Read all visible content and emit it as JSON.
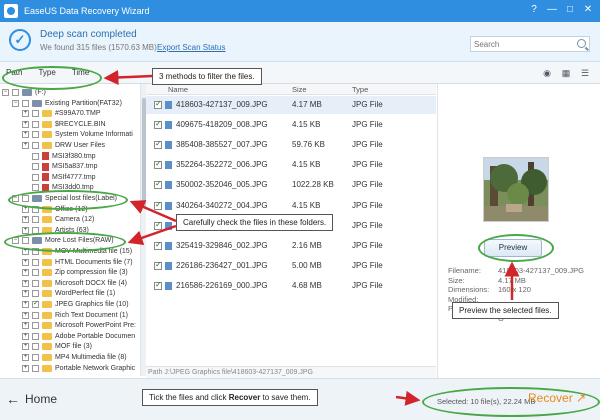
{
  "window": {
    "title": "EaseUS Data Recovery Wizard",
    "controls": [
      "?",
      "—",
      "□",
      "✕"
    ]
  },
  "scan": {
    "status": "Deep scan completed",
    "summary": "We found 315 files (1570.63 MB)",
    "export_link": "Export Scan Status",
    "search_placeholder": "Search"
  },
  "filter_tabs": [
    "Path",
    "Type",
    "Time"
  ],
  "tree": [
    {
      "label": "(F:)",
      "depth": 0,
      "kind": "drive"
    },
    {
      "label": "Existing Partition(FAT32)",
      "depth": 1,
      "kind": "drive"
    },
    {
      "label": "#S99A70.TMP",
      "depth": 2,
      "kind": "folder"
    },
    {
      "label": "$RECYCLE.BIN",
      "depth": 2,
      "kind": "folder"
    },
    {
      "label": "System Volume Informati",
      "depth": 2,
      "kind": "folder"
    },
    {
      "label": "DRW User Files",
      "depth": 2,
      "kind": "folder"
    },
    {
      "label": "MSI3f380.tmp",
      "depth": 2,
      "kind": "file"
    },
    {
      "label": "MSI5a837.tmp",
      "depth": 2,
      "kind": "file"
    },
    {
      "label": "MSIf4777.tmp",
      "depth": 2,
      "kind": "file"
    },
    {
      "label": "MSI3dd0.tmp",
      "depth": 2,
      "kind": "file"
    },
    {
      "label": "Special lost files(Label)",
      "depth": 1,
      "kind": "drive"
    },
    {
      "label": "Office (12)",
      "depth": 2,
      "kind": "folder"
    },
    {
      "label": "Camera (12)",
      "depth": 2,
      "kind": "folder"
    },
    {
      "label": "Artists (63)",
      "depth": 2,
      "kind": "folder"
    },
    {
      "label": "More Lost Files(RAW)",
      "depth": 1,
      "kind": "drive"
    },
    {
      "label": "MOV Multimedia file (15)",
      "depth": 2,
      "kind": "folder"
    },
    {
      "label": "HTML Documents file (7)",
      "depth": 2,
      "kind": "folder"
    },
    {
      "label": "Zip compression file (3)",
      "depth": 2,
      "kind": "folder"
    },
    {
      "label": "Microsoft DOCX file (4)",
      "depth": 2,
      "kind": "folder"
    },
    {
      "label": "WordPerfect file (1)",
      "depth": 2,
      "kind": "folder"
    },
    {
      "label": "JPEG Graphics file (10)",
      "depth": 2,
      "kind": "folder"
    },
    {
      "label": "Rich Text Document (1)",
      "depth": 2,
      "kind": "folder"
    },
    {
      "label": "Microsoft PowerPoint Pre:",
      "depth": 2,
      "kind": "folder"
    },
    {
      "label": "Adobe Portable Documen",
      "depth": 2,
      "kind": "folder"
    },
    {
      "label": "MOF file (3)",
      "depth": 2,
      "kind": "folder"
    },
    {
      "label": "MP4 Multimedia file (8)",
      "depth": 2,
      "kind": "folder"
    },
    {
      "label": "Portable Network Graphic",
      "depth": 2,
      "kind": "folder"
    }
  ],
  "columns": {
    "name": "Name",
    "size": "Size",
    "type": "Type"
  },
  "files": [
    {
      "name": "418603-427137_009.JPG",
      "size": "4.17 MB",
      "type": "JPG File"
    },
    {
      "name": "409675-418209_008.JPG",
      "size": "4.15 KB",
      "type": "JPG File"
    },
    {
      "name": "385408-385527_007.JPG",
      "size": "59.76 KB",
      "type": "JPG File"
    },
    {
      "name": "352264-352272_006.JPG",
      "size": "4.15 KB",
      "type": "JPG File"
    },
    {
      "name": "350002-352046_005.JPG",
      "size": "1022.28 KB",
      "type": "JPG File"
    },
    {
      "name": "340264-340272_004.JPG",
      "size": "4.15 KB",
      "type": "JPG File"
    },
    {
      "name": "326328-336336_003.JPG",
      "size": "4.15 KB",
      "type": "JPG File"
    },
    {
      "name": "325419-329846_002.JPG",
      "size": "2.16 MB",
      "type": "JPG File"
    },
    {
      "name": "226186-236427_001.JPG",
      "size": "5.00 MB",
      "type": "JPG File"
    },
    {
      "name": "216586-226169_000.JPG",
      "size": "4.68 MB",
      "type": "JPG File"
    }
  ],
  "path_text": "Path    J:\\JPEG Graphics file\\418603-427137_009.JPG",
  "preview": {
    "button": "Preview",
    "meta": [
      {
        "k": "Filename:",
        "v": "418603-427137_009.JPG"
      },
      {
        "k": "Size:",
        "v": "4.17 MB"
      },
      {
        "k": "Dimensions:",
        "v": "160 x 120"
      },
      {
        "k": "Modified:",
        "v": ""
      },
      {
        "k": "Path:",
        "v": "J:"
      },
      {
        "k": "",
        "v": "G"
      }
    ]
  },
  "footer": {
    "home": "Home",
    "selected": "Selected: 10 file(s), 22.24 MB",
    "recover": "Recover"
  },
  "callouts": {
    "filter": "3 methods to filter the files.",
    "check": "Carefully check the files in these folders.",
    "preview": "Preview the selected files.",
    "recover_pre": "Tick the files and click ",
    "recover_bold": "Recover",
    "recover_post": " to save them."
  },
  "colors": {
    "accent": "#2f8ee0",
    "highlight": "#49a746",
    "arrow": "#d2242b",
    "recover": "#e58a1c"
  }
}
